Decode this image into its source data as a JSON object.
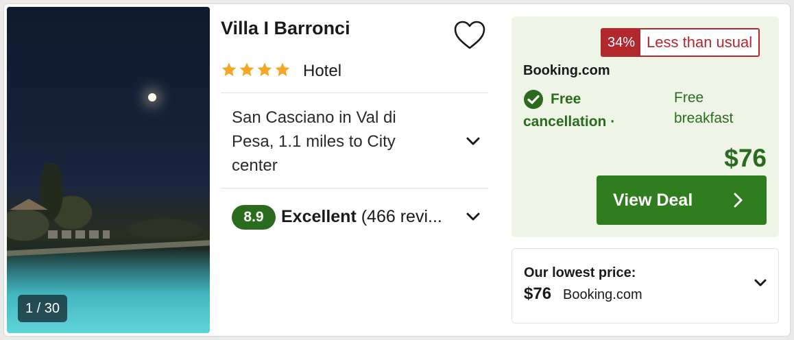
{
  "gallery": {
    "counter": "1 / 30"
  },
  "hotel": {
    "name": "Villa I Barronci",
    "star_rating": 4,
    "type": "Hotel",
    "location": "San Casciano in Val di Pesa, 1.1 miles to City center",
    "rating_score": "8.9",
    "rating_label": "Excellent",
    "review_text": "(466 revi..."
  },
  "deal": {
    "discount_percent": "34%",
    "discount_message": "Less than usual",
    "provider": "Booking.com",
    "free_cancellation": "Free cancellation ·",
    "free_breakfast": "Free breakfast",
    "price": "$76",
    "view_deal_label": "View Deal"
  },
  "lowest_price": {
    "label": "Our lowest price:",
    "price": "$76",
    "provider": "Booking.com"
  },
  "colors": {
    "accent_green": "#2f7d1f",
    "deal_background": "#eef4e6",
    "discount_red": "#b3282d",
    "star_orange": "#f5a623"
  },
  "icons": [
    "heart-icon",
    "star-icon",
    "chevron-down-icon",
    "check-circle-icon",
    "chevron-right-icon"
  ]
}
